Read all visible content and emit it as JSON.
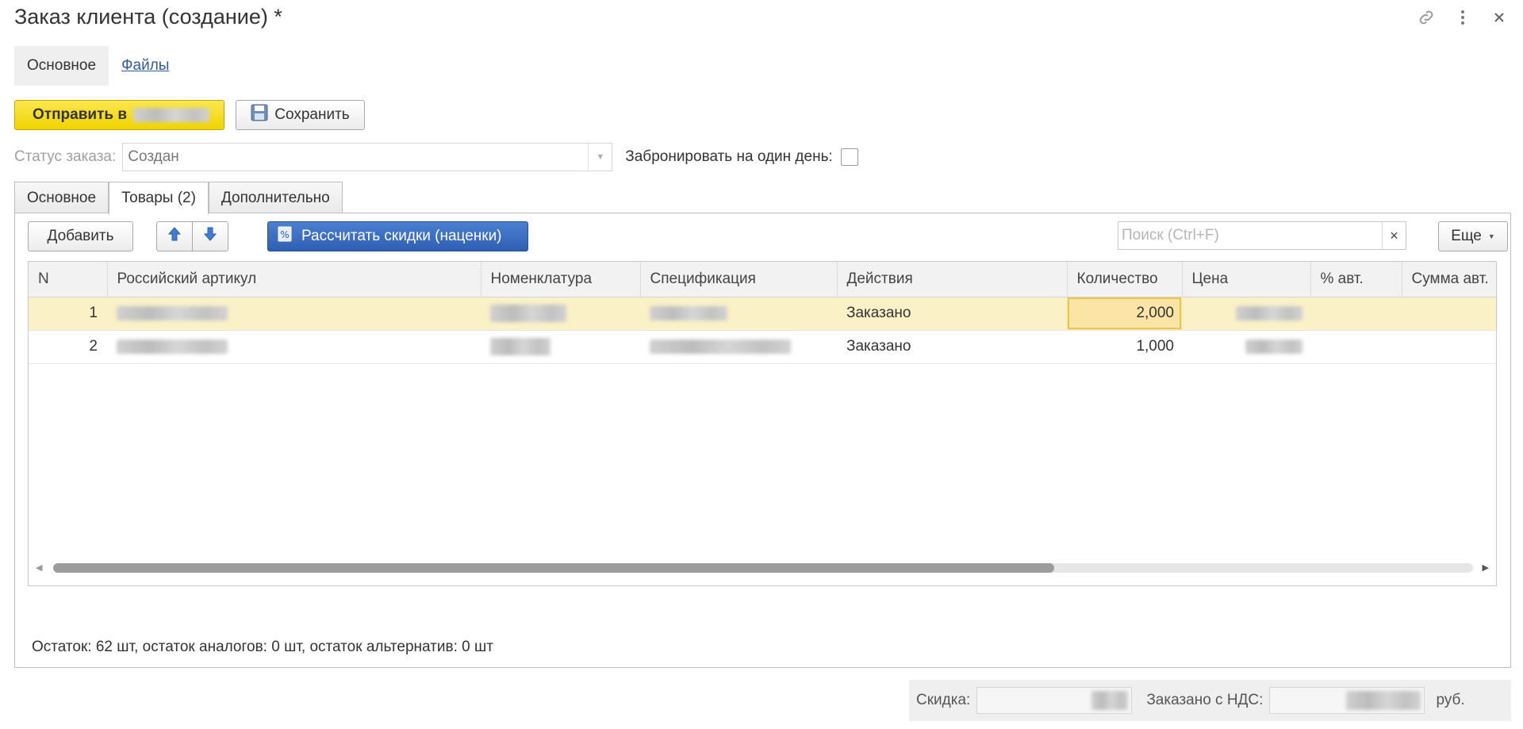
{
  "window": {
    "title": "Заказ клиента (создание) *"
  },
  "topnav": {
    "main": "Основное",
    "files": "Файлы"
  },
  "commands": {
    "send_label": "Отправить в",
    "save_label": "Сохранить"
  },
  "status": {
    "label": "Статус заказа:",
    "value": "Создан",
    "reserve_label": "Забронировать на один день:",
    "reserve_checked": false
  },
  "tabs": [
    {
      "label": "Основное",
      "active": false
    },
    {
      "label": "Товары (2)",
      "active": true
    },
    {
      "label": "Дополнительно",
      "active": false
    }
  ],
  "toolbar": {
    "add_label": "Добавить",
    "calc_label": "Рассчитать скидки (наценки)",
    "search_placeholder": "Поиск (Ctrl+F)",
    "more_label": "Еще"
  },
  "table": {
    "columns": [
      "N",
      "Российский артикул",
      "Номенклатура",
      "Спецификация",
      "Действия",
      "Количество",
      "Цена",
      "% авт.",
      "Сумма авт."
    ],
    "rows": [
      {
        "n": "1",
        "action": "Заказано",
        "quantity": "2,000",
        "selected": true
      },
      {
        "n": "2",
        "action": "Заказано",
        "quantity": "1,000",
        "selected": false
      }
    ]
  },
  "stock_info": "Остаток: 62 шт, остаток аналогов: 0 шт, остаток альтернатив: 0 шт",
  "footer": {
    "discount_label": "Скидка:",
    "ordered_vat_label": "Заказано с НДС:",
    "currency": "руб."
  },
  "colors": {
    "accent_yellow": "#f0d400",
    "accent_blue": "#2f5fb4",
    "selected_row": "#fbf1c7",
    "link": "#2e5a9e"
  }
}
